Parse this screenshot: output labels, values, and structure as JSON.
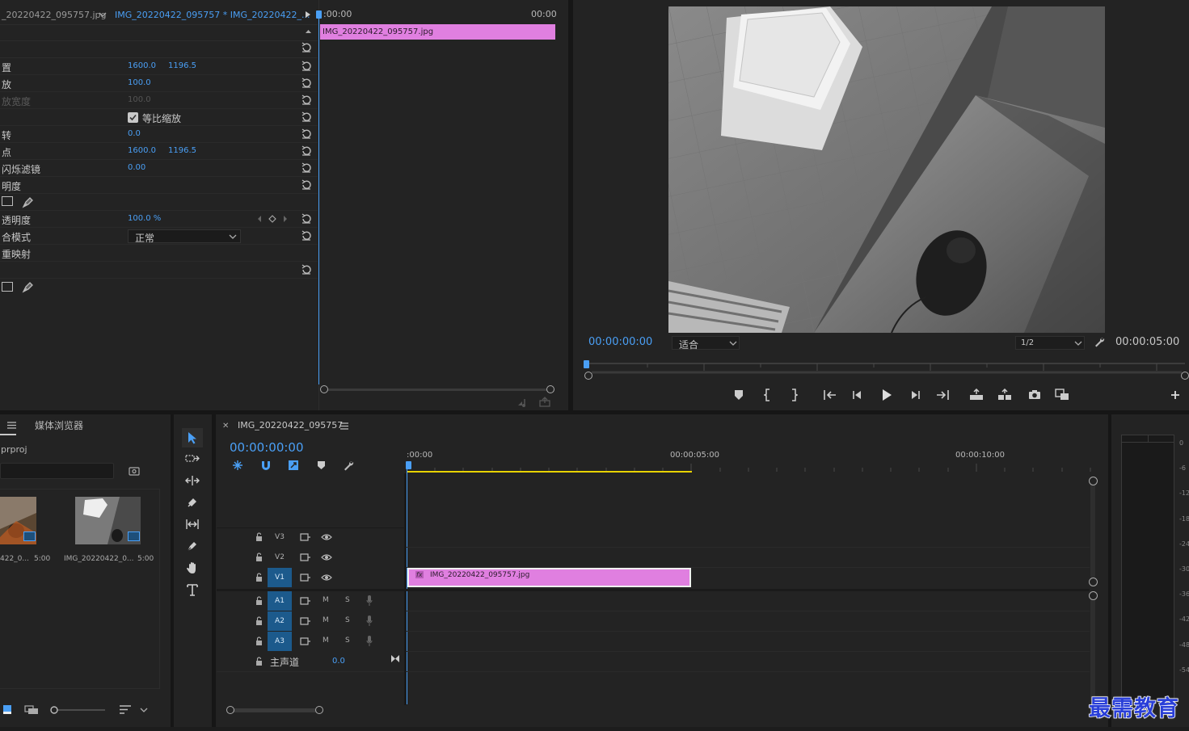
{
  "effect_controls": {
    "source_tab": "_20220422_095757.jpg",
    "sequence_tab": "IMG_20220422_095757 * IMG_20220422_...",
    "time_start": ":00:00",
    "time_end": "00:00",
    "clip_label": "IMG_20220422_095757.jpg",
    "rows": [
      {
        "label": "置",
        "v1": "1600.0",
        "v2": "1196.5"
      },
      {
        "label": "放",
        "v1": "100.0",
        "v2": ""
      },
      {
        "label": "放宽度",
        "v1": "100.0",
        "v2": ""
      },
      {
        "label": "",
        "v1": "",
        "v2": ""
      },
      {
        "label": "转",
        "v1": "0.0",
        "v2": ""
      },
      {
        "label": "点",
        "v1": "1600.0",
        "v2": "1196.5"
      },
      {
        "label": "闪烁滤镜",
        "v1": "0.00",
        "v2": ""
      },
      {
        "label": "明度",
        "v1": "",
        "v2": ""
      },
      {
        "label": "",
        "v1": "",
        "v2": ""
      },
      {
        "label": "透明度",
        "v1": "100.0 %",
        "v2": ""
      },
      {
        "label": "合模式",
        "v1": "",
        "v2": ""
      },
      {
        "label": "重映射",
        "v1": "",
        "v2": ""
      }
    ],
    "uniform_scale_label": "等比缩放",
    "blend_mode_value": "正常"
  },
  "program_monitor": {
    "timecode": "00:00:00:00",
    "fit_option": "适合",
    "resolution": "1/2",
    "duration": "00:00:05:00"
  },
  "project_panel": {
    "tab_media_browser": "媒体浏览器",
    "project_name": "prproj",
    "items": [
      {
        "name": "422_0...",
        "duration": "5:00"
      },
      {
        "name": "IMG_20220422_0...",
        "duration": "5:00"
      }
    ]
  },
  "timeline": {
    "sequence_name": "IMG_20220422_095757",
    "timecode": "00:00:00:00",
    "ruler": [
      ":00:00",
      "00:00:05:00",
      "00:00:10:00"
    ],
    "video_tracks": [
      "V3",
      "V2",
      "V1"
    ],
    "audio_tracks": [
      "A1",
      "A2",
      "A3"
    ],
    "mute_label": "M",
    "solo_label": "S",
    "master_label": "主声道",
    "master_value": "0.0",
    "clip_label": "IMG_20220422_095757.jpg",
    "clip_fx": "fx"
  },
  "audio_meter": {
    "ticks": [
      "0",
      "-6",
      "-12",
      "-18",
      "-24",
      "-30",
      "-36",
      "-42",
      "-48",
      "-54"
    ]
  },
  "watermark": "最需教育",
  "colors": {
    "accent_blue": "#4a9ff5",
    "clip_pink": "#e07fe0",
    "work_area_yellow": "#e8d200",
    "track_selected": "#1c5a8c"
  }
}
